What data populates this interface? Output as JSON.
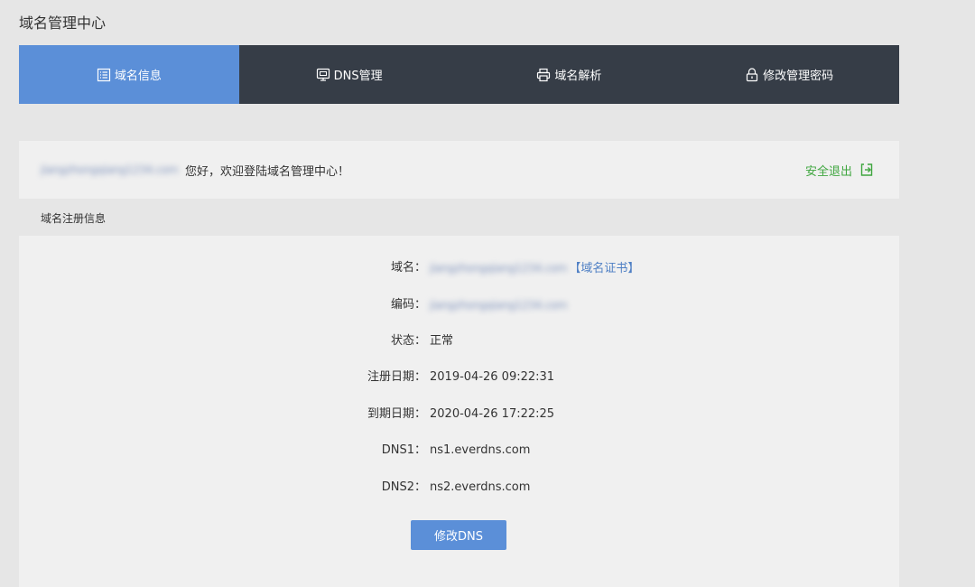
{
  "page_title": "域名管理中心",
  "tabs": [
    {
      "label": "域名信息",
      "icon": "list-icon",
      "active": true
    },
    {
      "label": "DNS管理",
      "icon": "monitor-icon",
      "active": false
    },
    {
      "label": "域名解析",
      "icon": "printer-icon",
      "active": false
    },
    {
      "label": "修改管理密码",
      "icon": "lock-icon",
      "active": false
    }
  ],
  "welcome": {
    "username": "jiangzhongqiang1234.com",
    "message": "您好，欢迎登陆域名管理中心！",
    "logout_label": "安全退出"
  },
  "section_label": "域名注册信息",
  "info": {
    "domain_label": "域名：",
    "domain_value": "jiangzhongqiang1234.com",
    "cert_link": "【域名证书】",
    "code_label": "编码：",
    "code_value": "jiangzhongqiang1234.com",
    "status_label": "状态：",
    "status_value": "正常",
    "reg_date_label": "注册日期：",
    "reg_date_value": "2019-04-26 09:22:31",
    "exp_date_label": "到期日期：",
    "exp_date_value": "2020-04-26 17:22:25",
    "dns1_label": "DNS1：",
    "dns1_value": "ns1.everdns.com",
    "dns2_label": "DNS2：",
    "dns2_value": "ns2.everdns.com"
  },
  "modify_dns_button": "修改DNS",
  "colors": {
    "active_tab": "#5b8fd8",
    "tab_bar": "#363d47",
    "logout": "#3fa63f",
    "link": "#4e7fc4"
  }
}
